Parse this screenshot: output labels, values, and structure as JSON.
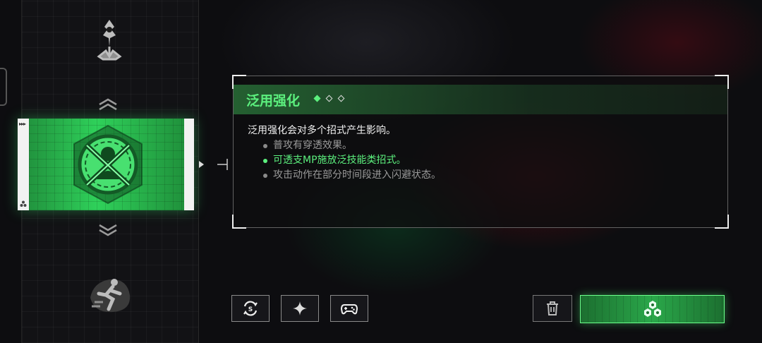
{
  "panel": {
    "title": "泛用强化",
    "description": "泛用强化会对多个招式产生影响。",
    "bullets": [
      {
        "text": "普攻有穿透效果。",
        "highlighted": false
      },
      {
        "text": "可透支MP施放泛技能类招式。",
        "highlighted": true
      },
      {
        "text": "攻击动作在部分时间段进入闪避状态。",
        "highlighted": false
      }
    ],
    "level_indicator": {
      "filled": 1,
      "total": 3
    }
  },
  "colors": {
    "accent_green": "#5cf07e",
    "panel_bg": "#0e0e10",
    "muted_text": "#9a9a9a"
  },
  "icons": {
    "top_skill": "flower-thorn-icon",
    "selected_skill": "crossed-swords-emblem-icon",
    "bottom_skill": "sprint-figure-icon",
    "swap": "swap-cycle-icon",
    "sparkle": "sparkle-icon",
    "gamepad": "gamepad-icon",
    "delete": "trash-icon",
    "equip": "hex-cluster-icon"
  }
}
